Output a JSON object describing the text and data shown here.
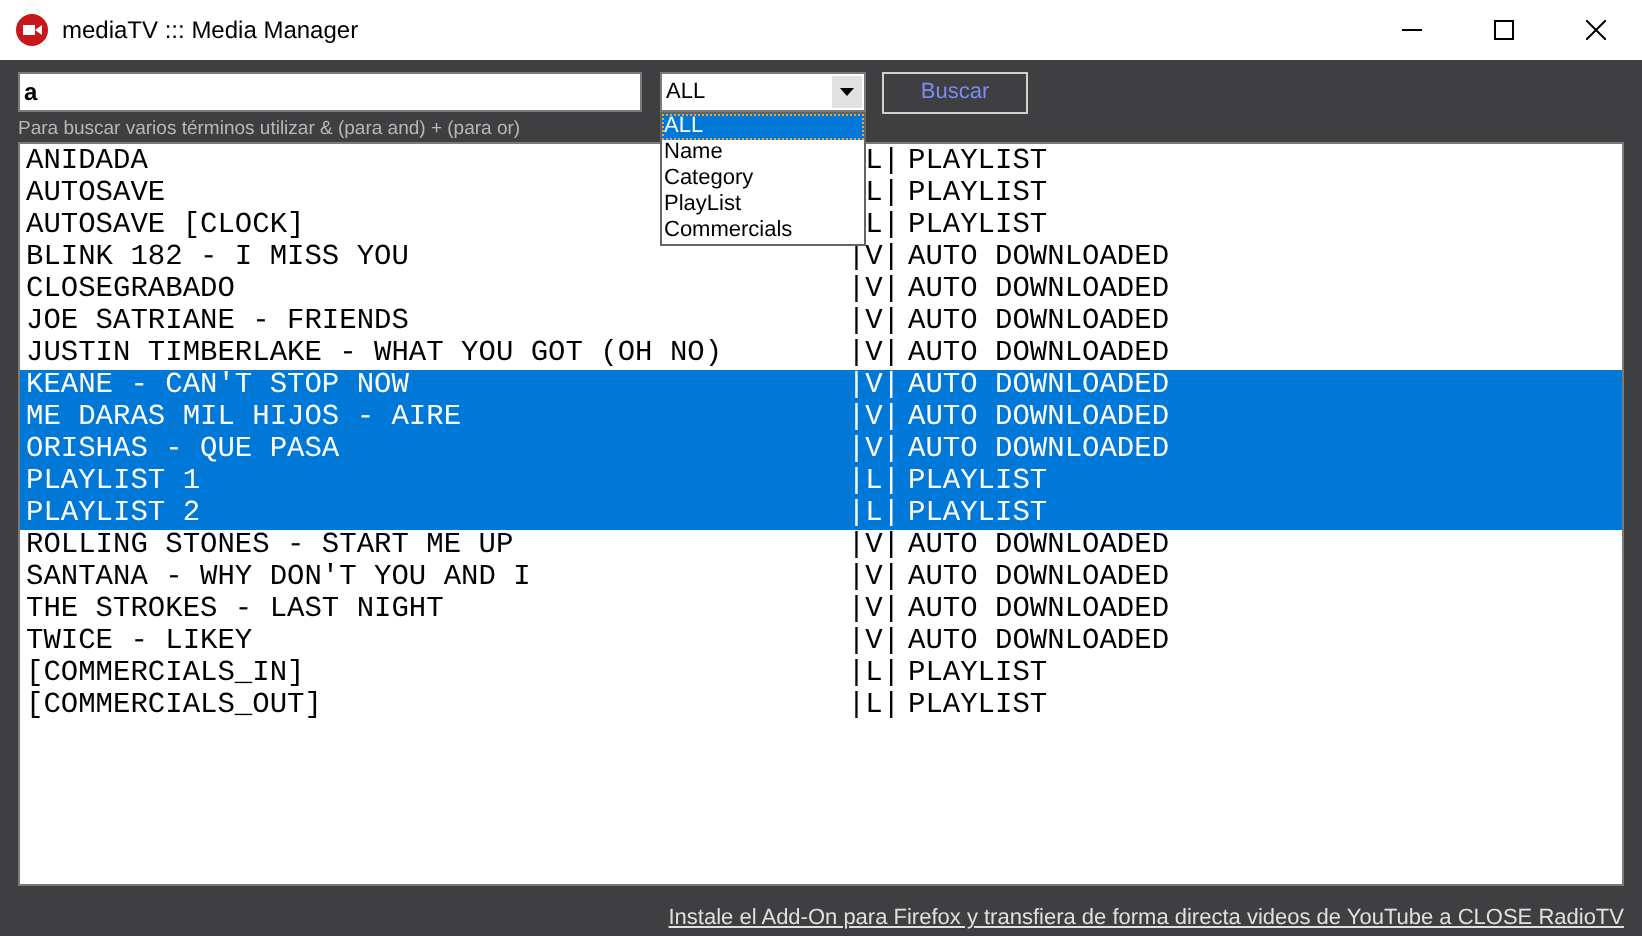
{
  "window": {
    "title": "mediaTV ::: Media Manager"
  },
  "search": {
    "value": "a",
    "hint": "Para buscar varios términos utilizar & (para and) + (para or)"
  },
  "filter": {
    "value": "ALL",
    "options": [
      {
        "label": "ALL",
        "selected": true
      },
      {
        "label": "Name",
        "selected": false
      },
      {
        "label": "Category",
        "selected": false
      },
      {
        "label": "PlayList",
        "selected": false
      },
      {
        "label": "Commercials",
        "selected": false
      }
    ]
  },
  "search_button": "Buscar",
  "rows": [
    {
      "name": "ANIDADA",
      "flag": "L|",
      "category": "PLAYLIST",
      "selected": false
    },
    {
      "name": "AUTOSAVE",
      "flag": "L|",
      "category": "PLAYLIST",
      "selected": false
    },
    {
      "name": "AUTOSAVE [CLOCK]",
      "flag": "L|",
      "category": "PLAYLIST",
      "selected": false
    },
    {
      "name": "BLINK 182 - I MISS YOU",
      "flag": "|V|",
      "category": "AUTO DOWNLOADED",
      "selected": false
    },
    {
      "name": "CLOSEGRABADO",
      "flag": "|V|",
      "category": "AUTO DOWNLOADED",
      "selected": false
    },
    {
      "name": "JOE SATRIANE - FRIENDS",
      "flag": "|V|",
      "category": "AUTO DOWNLOADED",
      "selected": false
    },
    {
      "name": "JUSTIN TIMBERLAKE - WHAT YOU GOT (OH NO)",
      "flag": "|V|",
      "category": "AUTO DOWNLOADED",
      "selected": false
    },
    {
      "name": "KEANE - CAN'T STOP NOW",
      "flag": "|V|",
      "category": "AUTO DOWNLOADED",
      "selected": true
    },
    {
      "name": "ME DARAS MIL HIJOS - AIRE",
      "flag": "|V|",
      "category": "AUTO DOWNLOADED",
      "selected": true
    },
    {
      "name": "ORISHAS - QUE PASA",
      "flag": "|V|",
      "category": "AUTO DOWNLOADED",
      "selected": true
    },
    {
      "name": "PLAYLIST 1",
      "flag": "|L|",
      "category": "PLAYLIST",
      "selected": true
    },
    {
      "name": "PLAYLIST 2",
      "flag": "|L|",
      "category": "PLAYLIST",
      "selected": true
    },
    {
      "name": "ROLLING STONES - START ME UP",
      "flag": "|V|",
      "category": "AUTO DOWNLOADED",
      "selected": false
    },
    {
      "name": "SANTANA - WHY DON'T YOU AND I",
      "flag": "|V|",
      "category": "AUTO DOWNLOADED",
      "selected": false
    },
    {
      "name": "THE STROKES - LAST NIGHT",
      "flag": "|V|",
      "category": "AUTO DOWNLOADED",
      "selected": false
    },
    {
      "name": "TWICE - LIKEY",
      "flag": "|V|",
      "category": "AUTO DOWNLOADED",
      "selected": false
    },
    {
      "name": "[COMMERCIALS_IN]",
      "flag": "|L|",
      "category": "PLAYLIST",
      "selected": false
    },
    {
      "name": "[COMMERCIALS_OUT]",
      "flag": "|L|",
      "category": "PLAYLIST",
      "selected": false
    }
  ],
  "footer_link": "Instale el Add-On para Firefox y transfiera de forma directa videos de YouTube a CLOSE RadioTV"
}
